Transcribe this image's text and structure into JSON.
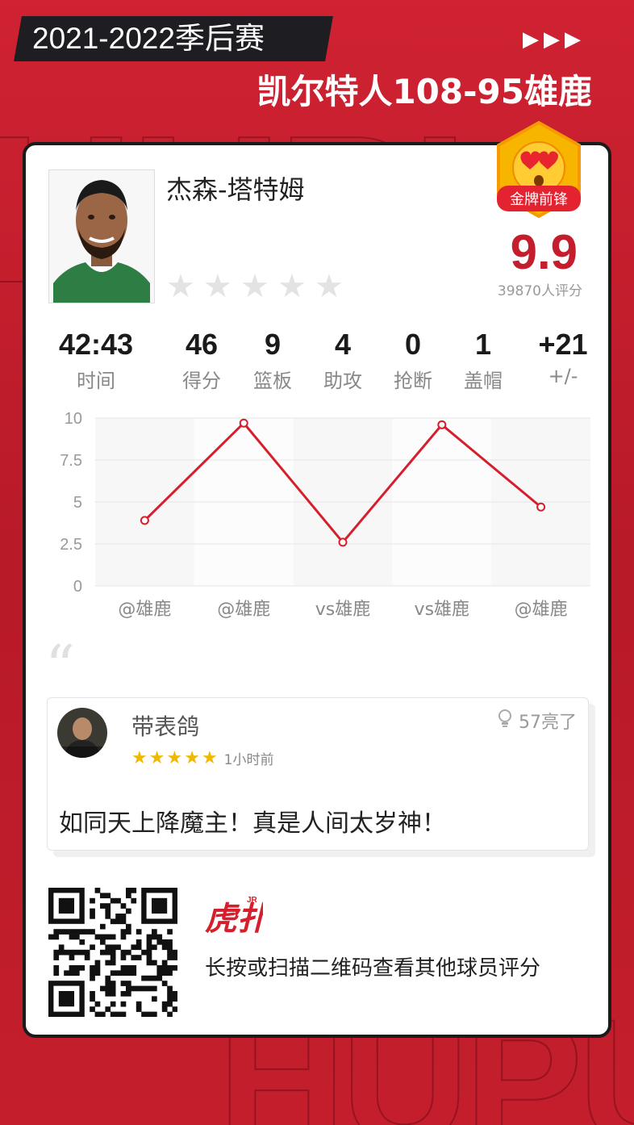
{
  "header": {
    "season": "2021-2022季后赛",
    "match": "凯尔特人108-95雄鹿",
    "arrows": "▶▶▶"
  },
  "player": {
    "name": "杰森-塔特姆",
    "badge": "金牌前锋",
    "score": "9.9",
    "raters": "39870人评分",
    "rating_stars": 0
  },
  "stats": [
    {
      "value": "42:43",
      "label": "时间"
    },
    {
      "value": "46",
      "label": "得分"
    },
    {
      "value": "9",
      "label": "篮板"
    },
    {
      "value": "4",
      "label": "助攻"
    },
    {
      "value": "0",
      "label": "抢断"
    },
    {
      "value": "1",
      "label": "盖帽"
    },
    {
      "value": "+21",
      "label": "+/-"
    }
  ],
  "chart_data": {
    "type": "line",
    "categories": [
      "@雄鹿",
      "@雄鹿",
      "vs雄鹿",
      "vs雄鹿",
      "@雄鹿"
    ],
    "values": [
      3.9,
      9.7,
      2.6,
      9.6,
      4.7
    ],
    "ylim": [
      0,
      10
    ],
    "yticks": [
      "0",
      "2.5",
      "5",
      "7.5",
      "10"
    ],
    "color": "#d61f2c",
    "grid": true
  },
  "comment": {
    "user": "带表鸽",
    "likes": "57亮了",
    "stars": 5,
    "time": "1小时前",
    "body": "如同天上降魔主！真是人间太岁神！"
  },
  "footer": {
    "logo": "虎扑",
    "hint": "长按或扫描二维码查看其他球员评分"
  },
  "colors": {
    "brand_red": "#c41e2c",
    "dark": "#1e1e22"
  }
}
